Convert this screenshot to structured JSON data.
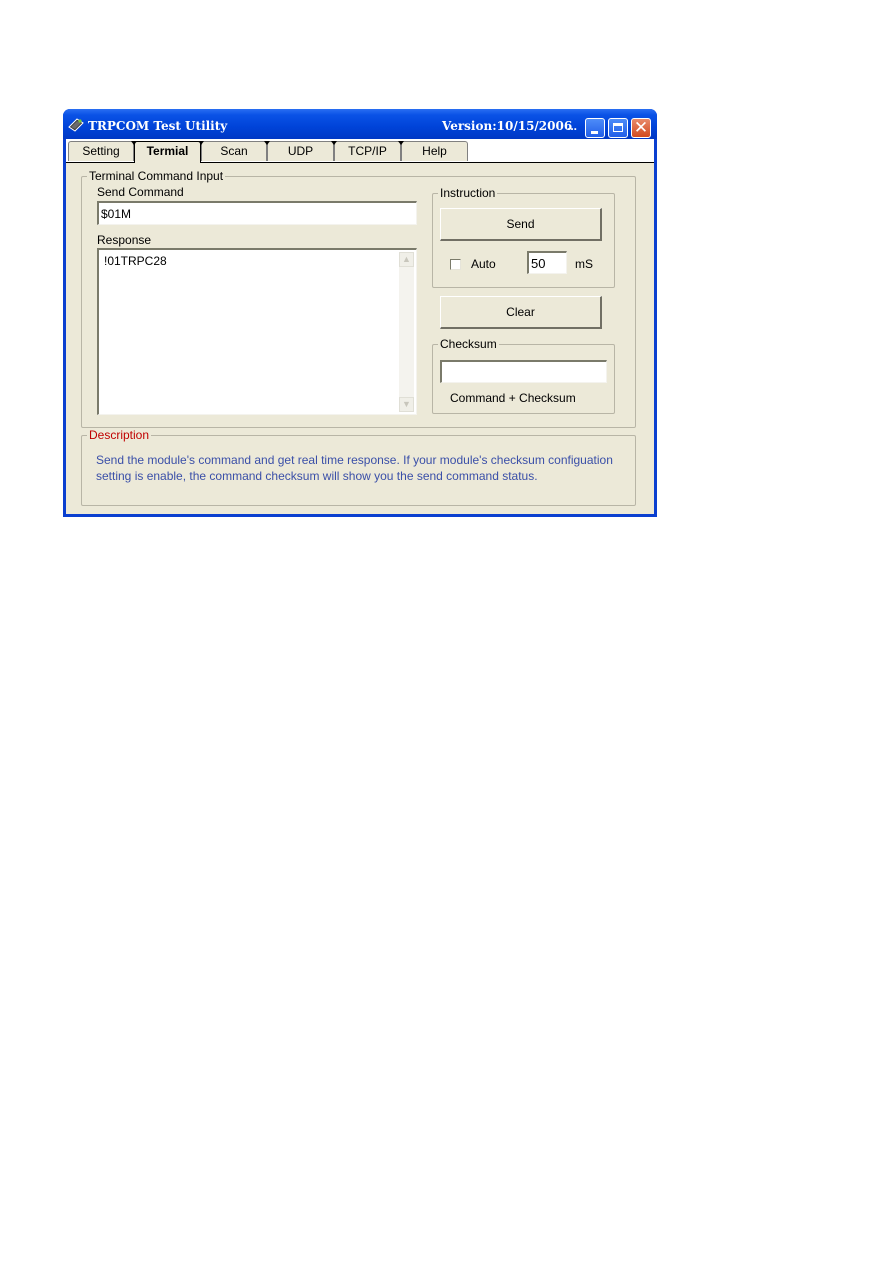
{
  "window": {
    "title": "TRPCOM Test Utility",
    "version": "Version:10/15/2006",
    "ellipsis": "...",
    "icon": "app-chip-icon",
    "controls": [
      "minimize-icon",
      "maximize-icon",
      "close-icon"
    ],
    "close_glyph": "✕"
  },
  "tabs": [
    {
      "label": "Setting",
      "active": false
    },
    {
      "label": "Termial",
      "active": true
    },
    {
      "label": "Scan",
      "active": false
    },
    {
      "label": "UDP",
      "active": false
    },
    {
      "label": "TCP/IP",
      "active": false
    },
    {
      "label": "Help",
      "active": false
    }
  ],
  "terminal": {
    "group_label": "Terminal Command Input",
    "send_command_label": "Send Command",
    "send_command_value": "$01M",
    "response_label": "Response",
    "response_value": "!01TRPC28",
    "scroll_up_glyph": "▲",
    "scroll_down_glyph": "▼"
  },
  "instruction": {
    "group_label": "Instruction",
    "send_button": "Send",
    "auto_label": "Auto",
    "auto_checked": false,
    "interval_value": "50",
    "interval_unit": "mS"
  },
  "clear_button": "Clear",
  "checksum": {
    "group_label": "Checksum",
    "value": "",
    "caption": "Command + Checksum"
  },
  "description": {
    "group_label": "Description",
    "text": "Send the module's command and get  real time response. If your module's checksum configuation setting is enable, the command checksum will show you the send command status."
  },
  "colors": {
    "title_bar": "#0a52e6",
    "client_bg": "#ece9d8",
    "description_label": "#c00000",
    "description_text": "#3a4fa8"
  }
}
